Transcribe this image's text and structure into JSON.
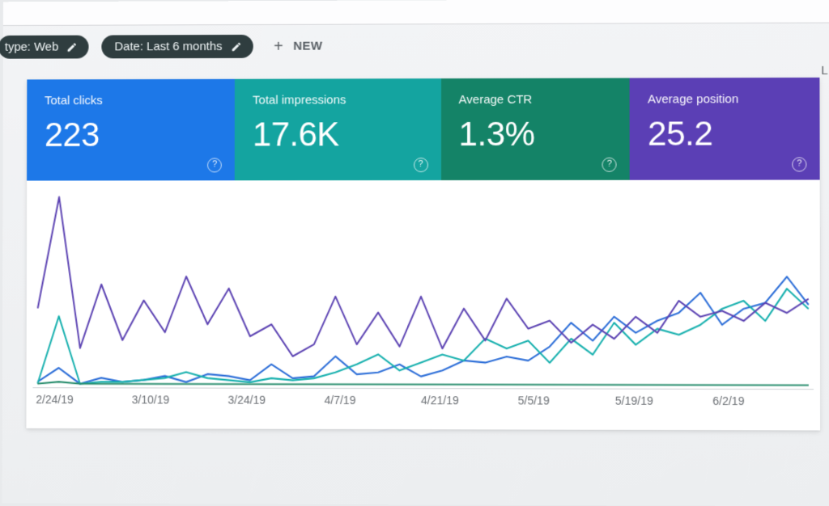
{
  "filters": {
    "type_chip": "type: Web",
    "date_chip": "Date: Last 6 months",
    "new_label": "NEW"
  },
  "right_cut_text": "L",
  "metrics": [
    {
      "label": "Total clicks",
      "value": "223",
      "color": "#1d78e8"
    },
    {
      "label": "Total impressions",
      "value": "17.6K",
      "color": "#14a4a0"
    },
    {
      "label": "Average CTR",
      "value": "1.3%",
      "color": "#148367"
    },
    {
      "label": "Average position",
      "value": "25.2",
      "color": "#5b3fb5"
    }
  ],
  "chart_data": {
    "type": "line",
    "xlabel": "",
    "ylabel": "",
    "categories": [
      "2/24/19",
      "3/10/19",
      "3/24/19",
      "4/7/19",
      "4/21/19",
      "5/5/19",
      "5/19/19",
      "6/2/19"
    ],
    "ylim": [
      0,
      10
    ],
    "series": [
      {
        "name": "Total clicks",
        "color": "#2e6fd8",
        "values": [
          0.3,
          1.0,
          0.2,
          0.5,
          0.3,
          0.4,
          0.6,
          0.3,
          0.7,
          0.6,
          0.4,
          1.2,
          0.5,
          0.6,
          1.6,
          0.7,
          0.8,
          1.2,
          0.6,
          0.9,
          1.4,
          1.3,
          1.6,
          1.4,
          2.1,
          3.3,
          2.4,
          3.6,
          2.8,
          3.4,
          3.8,
          4.8,
          3.2,
          4.0,
          4.3,
          5.6,
          4.2
        ]
      },
      {
        "name": "Total impressions",
        "color": "#17b0ae",
        "values": [
          0.2,
          3.6,
          0.2,
          0.3,
          0.3,
          0.4,
          0.5,
          0.8,
          0.5,
          0.4,
          0.3,
          0.5,
          0.4,
          0.5,
          0.8,
          1.2,
          1.7,
          0.9,
          1.3,
          1.7,
          1.4,
          2.5,
          2.0,
          2.4,
          1.3,
          2.5,
          1.7,
          3.3,
          2.2,
          3.0,
          2.7,
          3.2,
          4.0,
          4.4,
          3.4,
          5.0,
          4.0
        ]
      },
      {
        "name": "Average CTR",
        "color": "#2c8f70",
        "values": [
          0.2,
          0.3,
          0.2,
          0.2,
          0.2,
          0.2,
          0.2,
          0.2,
          0.2,
          0.2,
          0.2,
          0.2,
          0.2,
          0.2,
          0.2,
          0.2,
          0.2,
          0.2,
          0.2,
          0.2,
          0.2,
          0.2,
          0.2,
          0.2,
          0.2,
          0.2,
          0.2,
          0.2,
          0.2,
          0.2,
          0.2,
          0.2,
          0.2,
          0.2,
          0.2,
          0.2,
          0.2
        ]
      },
      {
        "name": "Average position",
        "color": "#5d44b3",
        "values": [
          4.0,
          9.6,
          2.0,
          5.2,
          2.4,
          4.4,
          2.8,
          5.6,
          3.2,
          5.0,
          2.6,
          3.2,
          1.6,
          2.2,
          4.6,
          2.2,
          3.8,
          2.1,
          4.6,
          2.0,
          4.0,
          2.4,
          4.5,
          3.0,
          3.4,
          2.3,
          3.2,
          2.5,
          3.6,
          2.8,
          4.4,
          3.6,
          3.9,
          3.4,
          4.3,
          3.8,
          4.5
        ]
      }
    ]
  }
}
